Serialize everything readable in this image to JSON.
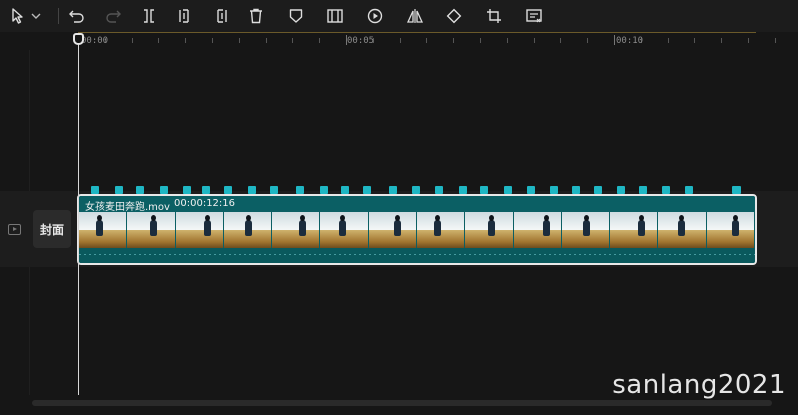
{
  "toolbar": {
    "buttons": [
      {
        "name": "select-tool-icon",
        "icon": "cursor"
      },
      {
        "name": "select-dropdown-icon",
        "icon": "chevron-down"
      },
      {
        "name": "undo-icon",
        "icon": "undo"
      },
      {
        "name": "redo-icon",
        "icon": "redo"
      },
      {
        "name": "split-icon",
        "icon": "split"
      },
      {
        "name": "trim-left-icon",
        "icon": "trim-left"
      },
      {
        "name": "trim-right-icon",
        "icon": "trim-right"
      },
      {
        "name": "delete-icon",
        "icon": "trash"
      },
      {
        "name": "marker-icon",
        "icon": "shield"
      },
      {
        "name": "freeze-frame-icon",
        "icon": "freeze"
      },
      {
        "name": "reverse-play-icon",
        "icon": "play-circle"
      },
      {
        "name": "mirror-icon",
        "icon": "mirror"
      },
      {
        "name": "rotate-icon",
        "icon": "rotate"
      },
      {
        "name": "crop-icon",
        "icon": "crop"
      },
      {
        "name": "auto-caption-icon",
        "icon": "caption"
      }
    ]
  },
  "ruler": {
    "labels": [
      "00:00",
      "00:05",
      "00:10"
    ]
  },
  "track": {
    "cover_label": "封面"
  },
  "clip": {
    "name": "女孩麦田奔跑.mov",
    "duration": "00:00:12:16",
    "thumbnail_count": 14,
    "keyframe_count": 29
  },
  "watermark": "sanlang2021",
  "colors": {
    "clip_fill": "#0c6a6f",
    "keyframe": "#1fb7c4",
    "playhead": "#d8d8d8",
    "background": "#161616"
  }
}
